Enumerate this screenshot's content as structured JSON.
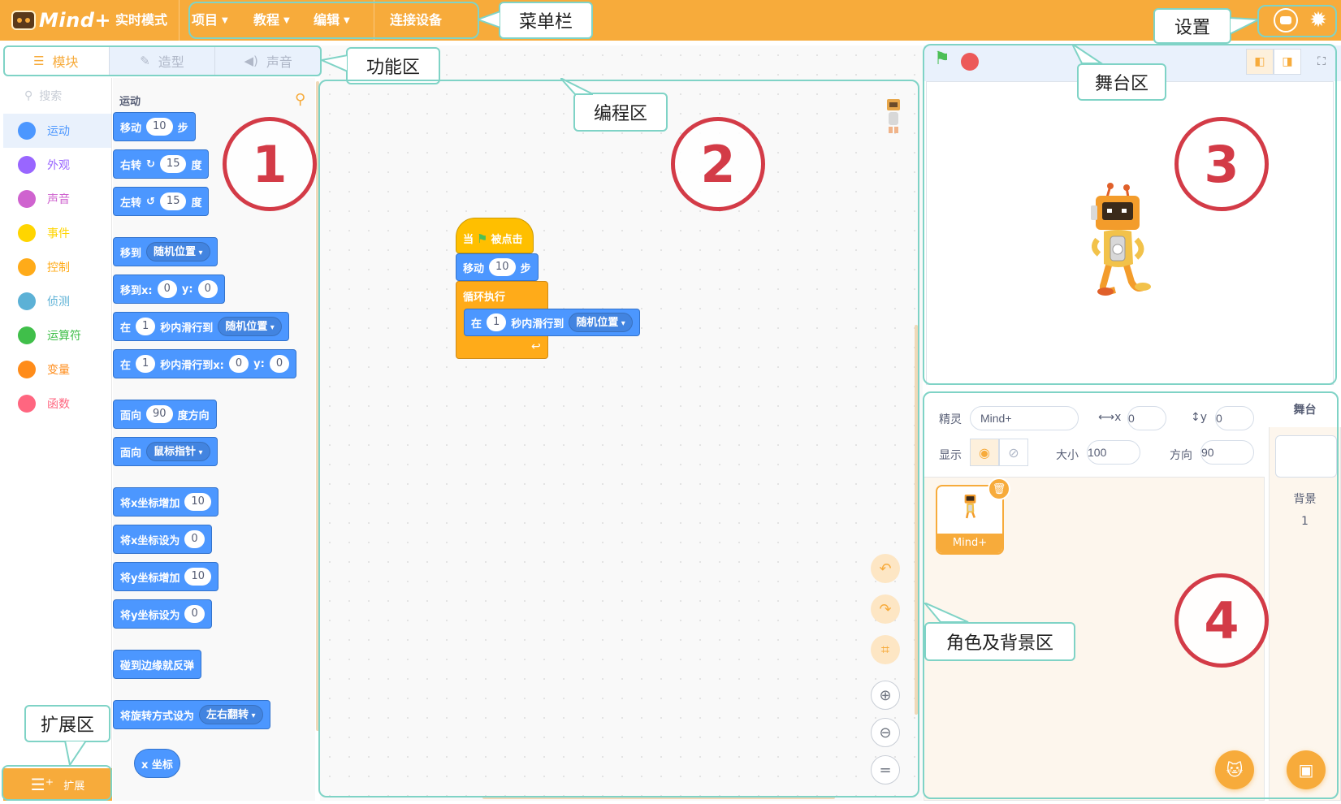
{
  "menubar": {
    "logo_text": "Mind+",
    "items": [
      "实时模式",
      "项目",
      "教程",
      "编辑",
      "连接设备"
    ],
    "icons": [
      "robot-icon",
      "gear-icon"
    ]
  },
  "func_tabs": [
    "模块",
    "造型",
    "声音"
  ],
  "categories": {
    "search_placeholder": "搜索",
    "items": [
      {
        "label": "运动",
        "color": "#4c97ff"
      },
      {
        "label": "外观",
        "color": "#9966ff"
      },
      {
        "label": "声音",
        "color": "#cf63cf"
      },
      {
        "label": "事件",
        "color": "#ffd500"
      },
      {
        "label": "控制",
        "color": "#ffab19"
      },
      {
        "label": "侦测",
        "color": "#5cb1d6"
      },
      {
        "label": "运算符",
        "color": "#40bf4a"
      },
      {
        "label": "变量",
        "color": "#ff8c1a"
      },
      {
        "label": "函数",
        "color": "#ff6680"
      }
    ]
  },
  "palette": {
    "title": "运动",
    "blocks": {
      "move": {
        "a": "移动",
        "v": "10",
        "b": "步"
      },
      "turn_right": {
        "a": "右转",
        "v": "15",
        "b": "度"
      },
      "turn_left": {
        "a": "左转",
        "v": "15",
        "b": "度"
      },
      "goto": {
        "a": "移到",
        "d": "随机位置"
      },
      "goto_xy": {
        "a": "移到x:",
        "x": "0",
        "b": "y:",
        "y": "0"
      },
      "glide": {
        "a": "在",
        "v": "1",
        "b": "秒内滑行到",
        "d": "随机位置"
      },
      "glide_xy": {
        "a": "在",
        "v": "1",
        "b": "秒内滑行到x:",
        "x": "0",
        "c": "y:",
        "y": "0"
      },
      "point_dir": {
        "a": "面向",
        "v": "90",
        "b": "度方向"
      },
      "point_towards": {
        "a": "面向",
        "d": "鼠标指针"
      },
      "change_x": {
        "a": "将x坐标增加",
        "v": "10"
      },
      "set_x": {
        "a": "将x坐标设为",
        "v": "0"
      },
      "change_y": {
        "a": "将y坐标增加",
        "v": "10"
      },
      "set_y": {
        "a": "将y坐标设为",
        "v": "0"
      },
      "bounce": {
        "a": "碰到边缘就反弹"
      },
      "rotation_style": {
        "a": "将旋转方式设为",
        "d": "左右翻转"
      },
      "x_reporter": {
        "a": "x 坐标"
      }
    }
  },
  "extension_label": "扩展",
  "script": {
    "hat": {
      "a": "当",
      "b": "被点击"
    },
    "move": {
      "a": "移动",
      "v": "10",
      "b": "步"
    },
    "loop": "循环执行",
    "glide": {
      "a": "在",
      "v": "1",
      "b": "秒内滑行到",
      "d": "随机位置"
    }
  },
  "sprite_info": {
    "sprite_label": "精灵",
    "sprite_name": "Mind+",
    "x_label": "x",
    "x": "0",
    "y_label": "y",
    "y": "0",
    "show_label": "显示",
    "size_label": "大小",
    "size": "100",
    "dir_label": "方向",
    "direction": "90"
  },
  "sprite_thumb_name": "Mind+",
  "backdrop": {
    "title": "舞台",
    "label": "背景",
    "count": "1"
  },
  "annotations": {
    "menubar": "菜单栏",
    "settings": "设置",
    "function_area": "功能区",
    "code_area": "编程区",
    "stage_area": "舞台区",
    "sprite_area": "角色及背景区",
    "extension_area": "扩展区",
    "numbers": [
      "1",
      "2",
      "3",
      "4"
    ]
  }
}
